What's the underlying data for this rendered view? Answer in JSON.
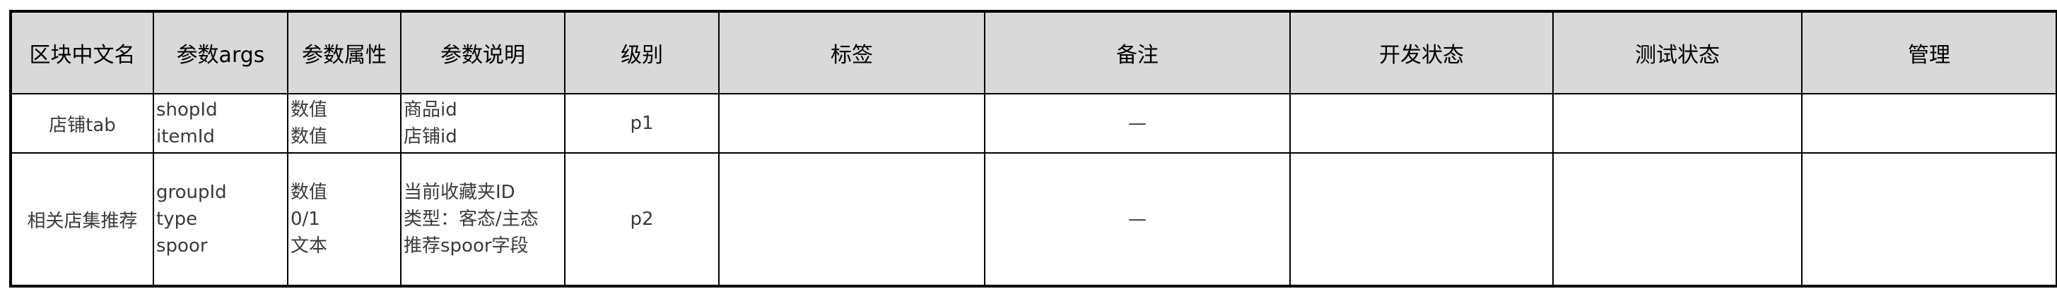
{
  "table": {
    "headers": [
      "区块中文名",
      "参数args",
      "参数属性",
      "参数说明",
      "级别",
      "标签",
      "备注",
      "开发状态",
      "测试状态",
      "管理"
    ],
    "rows": [
      {
        "block_name": "店铺tab",
        "args": [
          "shopId",
          "itemId"
        ],
        "attrs": [
          "数值",
          "数值"
        ],
        "desc": [
          "商品id",
          "店铺id"
        ],
        "level": "p1",
        "tags": "",
        "remark": "—",
        "dev_status": "",
        "test_status": "",
        "manage": ""
      },
      {
        "block_name": "相关店集推荐",
        "args": [
          "groupId",
          "type",
          "spoor"
        ],
        "attrs": [
          "数值",
          "0/1",
          "文本"
        ],
        "desc": [
          "当前收藏夹ID",
          "类型：客态/主态",
          "推荐spoor字段"
        ],
        "level": "p2",
        "tags": "",
        "remark": "—",
        "dev_status": "",
        "test_status": "",
        "manage": ""
      }
    ]
  },
  "colors": {
    "header_bg": "#d9d9d9",
    "border": "#000000",
    "text": "#333333"
  }
}
